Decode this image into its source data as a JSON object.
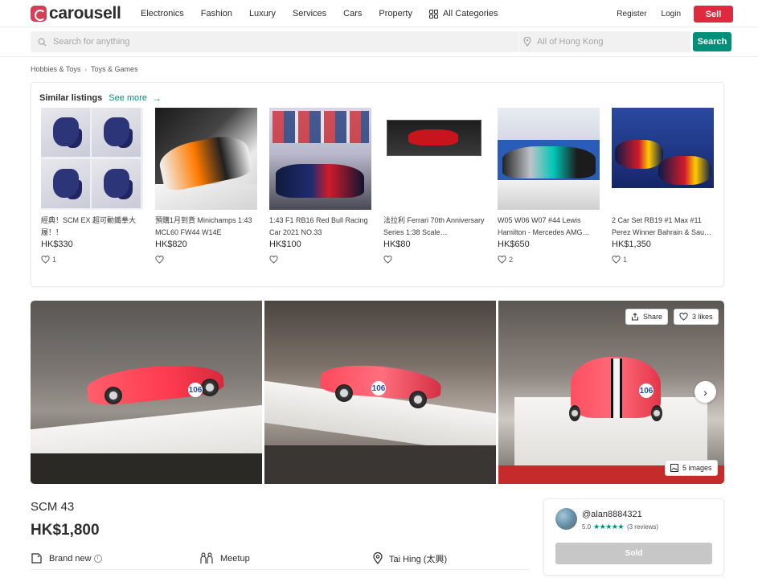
{
  "nav": {
    "logo_text": "carousell",
    "links": [
      "Electronics",
      "Fashion",
      "Luxury",
      "Services",
      "Cars",
      "Property"
    ],
    "all_categories": "All Categories",
    "register": "Register",
    "login": "Login",
    "sell": "Sell"
  },
  "search": {
    "placeholder": "Search for anything",
    "location_placeholder": "All of Hong Kong",
    "button": "Search"
  },
  "breadcrumb": [
    "Hobbies & Toys",
    "Toys & Games"
  ],
  "similar": {
    "title": "Similar listings",
    "see_more": "See more",
    "items": [
      {
        "title": "經典！SCM EX 超可動鐵拳大履！！",
        "price": "HK$330",
        "likes": "1"
      },
      {
        "title": "預購1月到貨 Minichamps 1:43 MCL60 FW44 W14E",
        "price": "HK$820",
        "likes": ""
      },
      {
        "title": "1:43 F1 RB16 Red Bull Racing Car 2021 NO.33",
        "price": "HK$100",
        "likes": ""
      },
      {
        "title": "法拉利 Ferrari 70th Anniversary Series 1:38 Scale…",
        "price": "HK$80",
        "likes": ""
      },
      {
        "title": "W05 W06 W07 #44 Lewis Hamilton - Mercedes AMG…",
        "price": "HK$650",
        "likes": "2"
      },
      {
        "title": "2 Car Set RB19 #1 Max #11 Perez Winner Bahrain & Sau…",
        "price": "HK$1,350",
        "likes": "1"
      }
    ]
  },
  "gallery": {
    "share": "Share",
    "likes": "3 likes",
    "images_count": "5 images",
    "car_numbers": [
      "106",
      "106",
      "106"
    ]
  },
  "listing": {
    "title": "SCM 43",
    "price": "HK$1,800",
    "condition": "Brand new",
    "delivery": "Meetup",
    "location": "Tai Hing (太興)"
  },
  "seller": {
    "username": "@alan8884321",
    "rating": "5.0",
    "stars": "★★★★★",
    "reviews": "(3 reviews)",
    "sold_label": "Sold"
  },
  "colors": {
    "brand_red": "#e0283e",
    "accent_green": "#008f79",
    "text": "#2c2c2d"
  }
}
